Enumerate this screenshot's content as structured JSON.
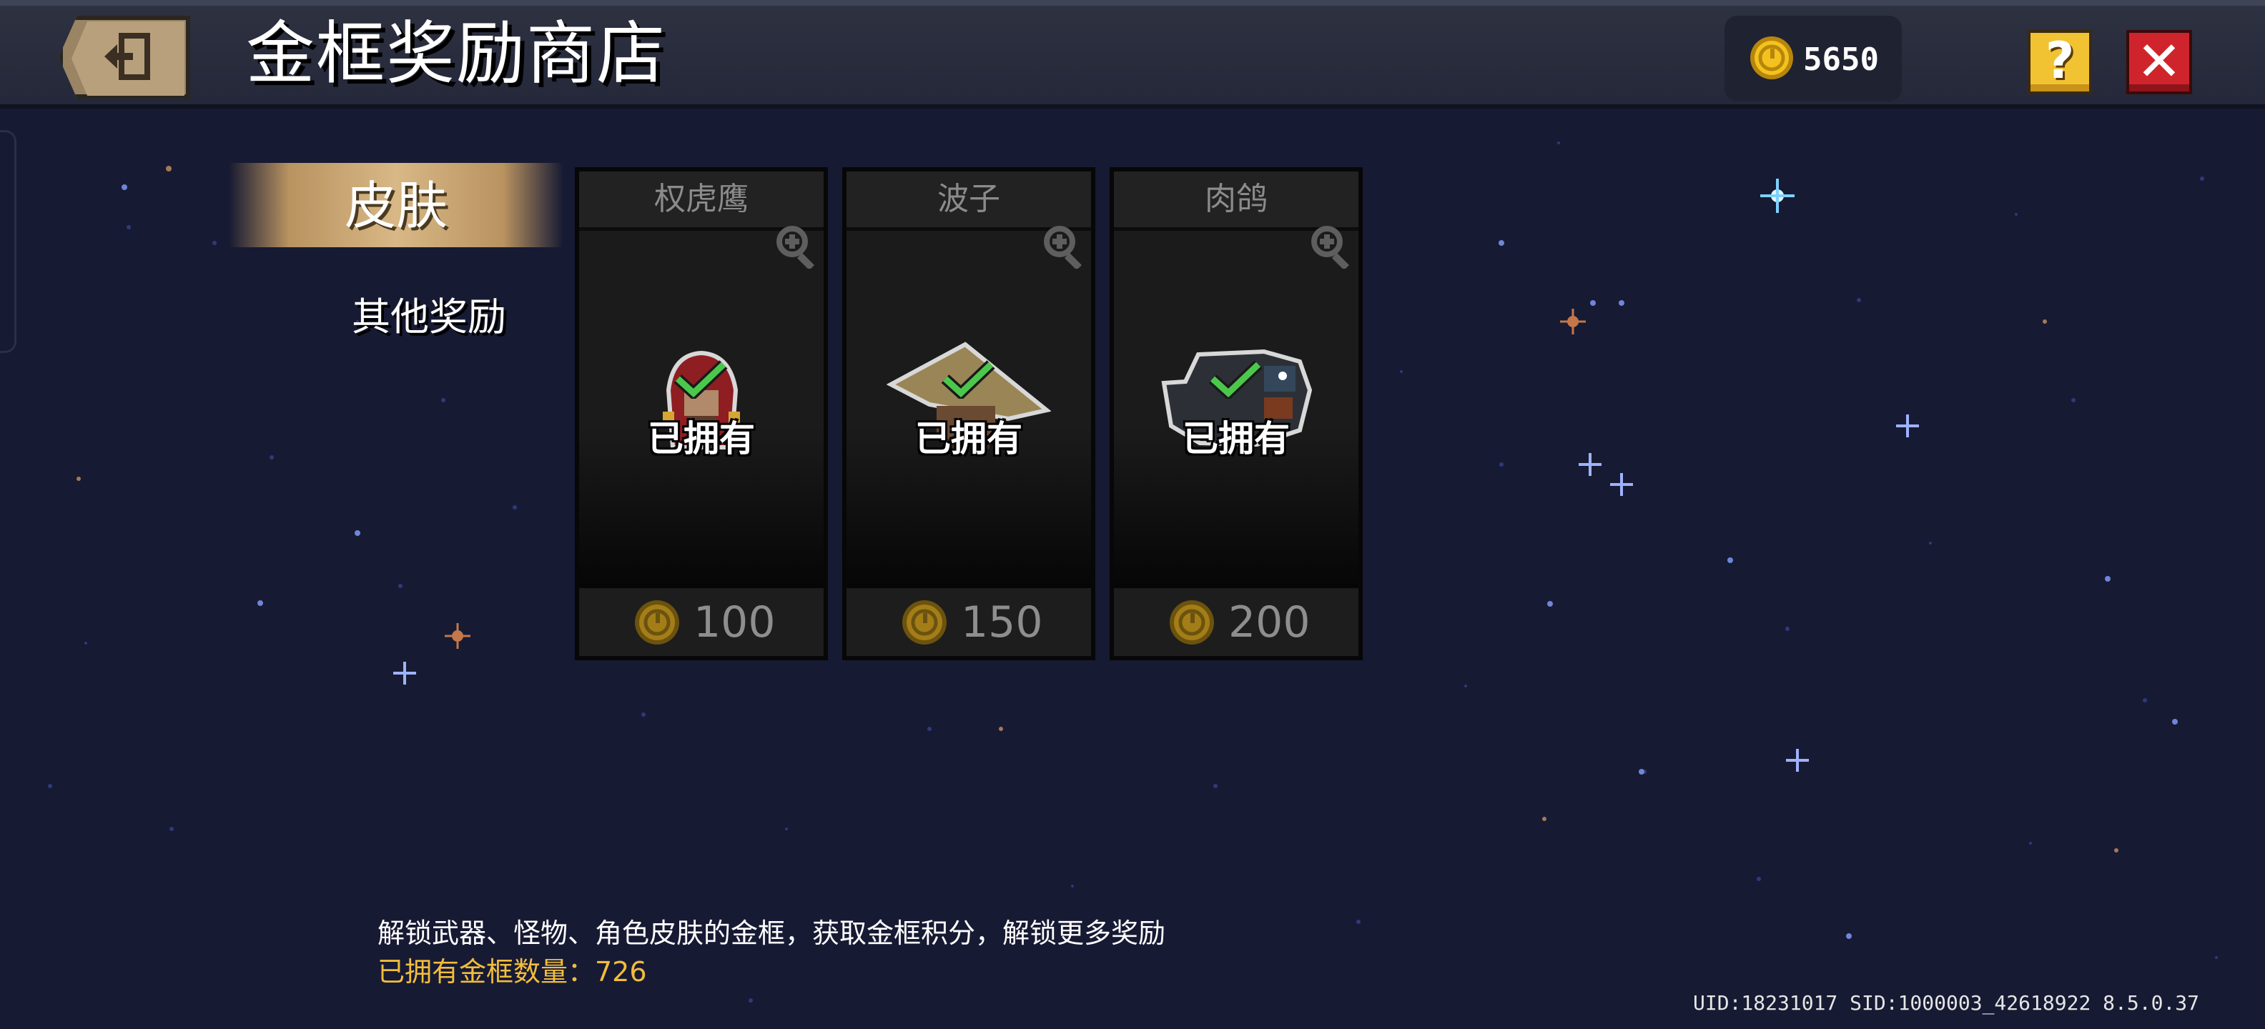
{
  "header": {
    "title": "金框奖励商店",
    "coins": "5650",
    "help_label": "?",
    "close_label": "✕"
  },
  "tabs": [
    {
      "label": "皮肤",
      "active": true
    },
    {
      "label": "其他奖励",
      "active": false
    }
  ],
  "cards": [
    {
      "name": "权虎鹰",
      "status": "已拥有",
      "price": "100",
      "icon": "red-hood-character-icon"
    },
    {
      "name": "波子",
      "status": "已拥有",
      "price": "150",
      "icon": "straw-hat-character-icon"
    },
    {
      "name": "肉鸽",
      "status": "已拥有",
      "price": "200",
      "icon": "pigeon-character-icon"
    }
  ],
  "footer": {
    "description": "解锁武器、怪物、角色皮肤的金框，获取金框积分，解锁更多奖励",
    "owned_count": "已拥有金框数量：726",
    "version": "UID:18231017 SID:1000003_42618922 8.5.0.37"
  },
  "colors": {
    "background": "#171a33",
    "gold_text": "#f2bd3c",
    "tab_active": "#c8a46c",
    "check": "#4bc84b"
  }
}
